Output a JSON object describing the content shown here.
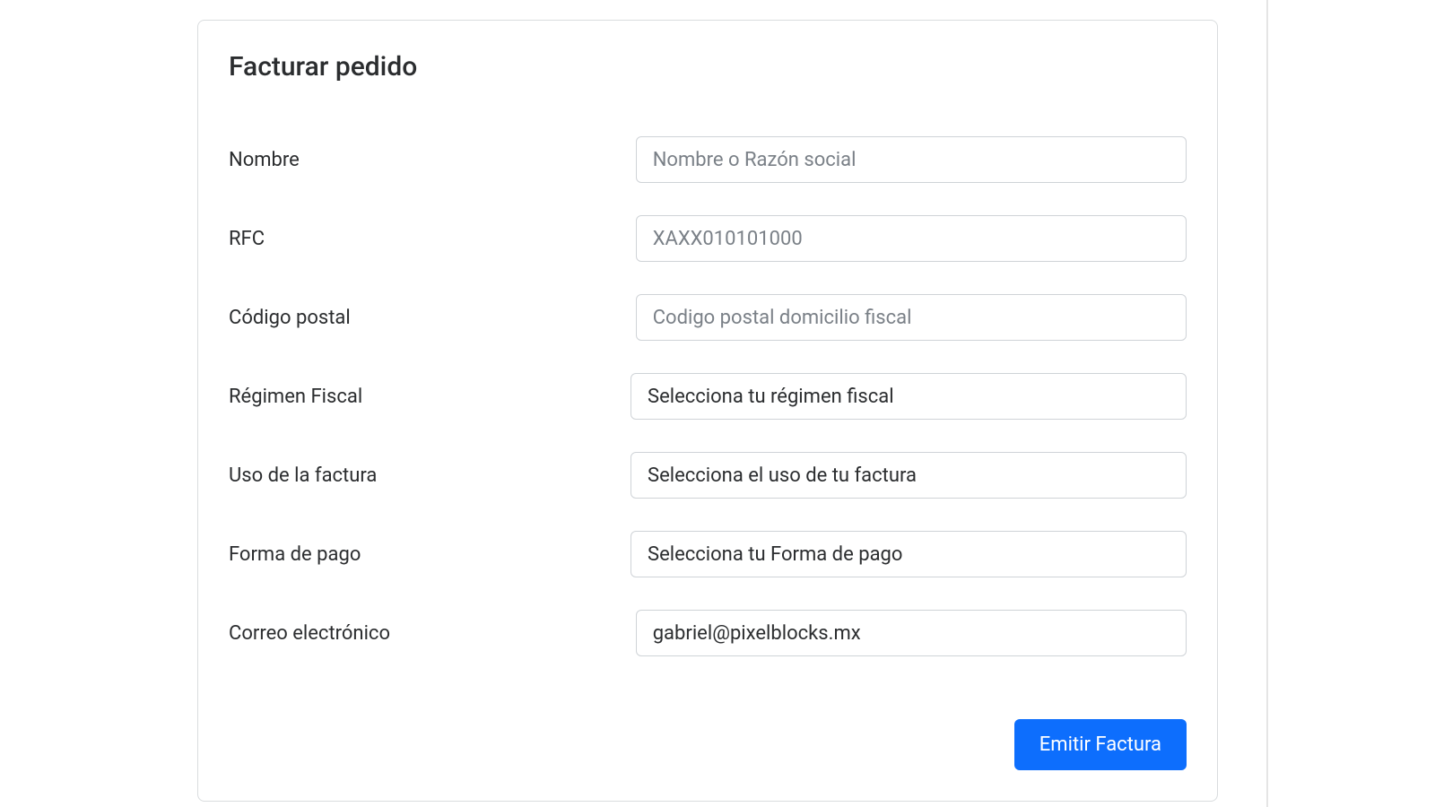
{
  "card": {
    "title": "Facturar pedido"
  },
  "form": {
    "nombre": {
      "label": "Nombre",
      "placeholder": "Nombre o Razón social",
      "value": ""
    },
    "rfc": {
      "label": "RFC",
      "placeholder": "XAXX010101000",
      "value": ""
    },
    "codigo_postal": {
      "label": "Código postal",
      "placeholder": "Codigo postal domicilio fiscal",
      "value": ""
    },
    "regimen_fiscal": {
      "label": "Régimen Fiscal",
      "selected": "Selecciona tu régimen fiscal"
    },
    "uso_factura": {
      "label": "Uso de la factura",
      "selected": "Selecciona el uso de tu factura"
    },
    "forma_pago": {
      "label": "Forma de pago",
      "selected": "Selecciona tu Forma de pago"
    },
    "correo": {
      "label": "Correo electrónico",
      "placeholder": "",
      "value": "gabriel@pixelblocks.mx"
    }
  },
  "actions": {
    "submit_label": "Emitir Factura"
  }
}
